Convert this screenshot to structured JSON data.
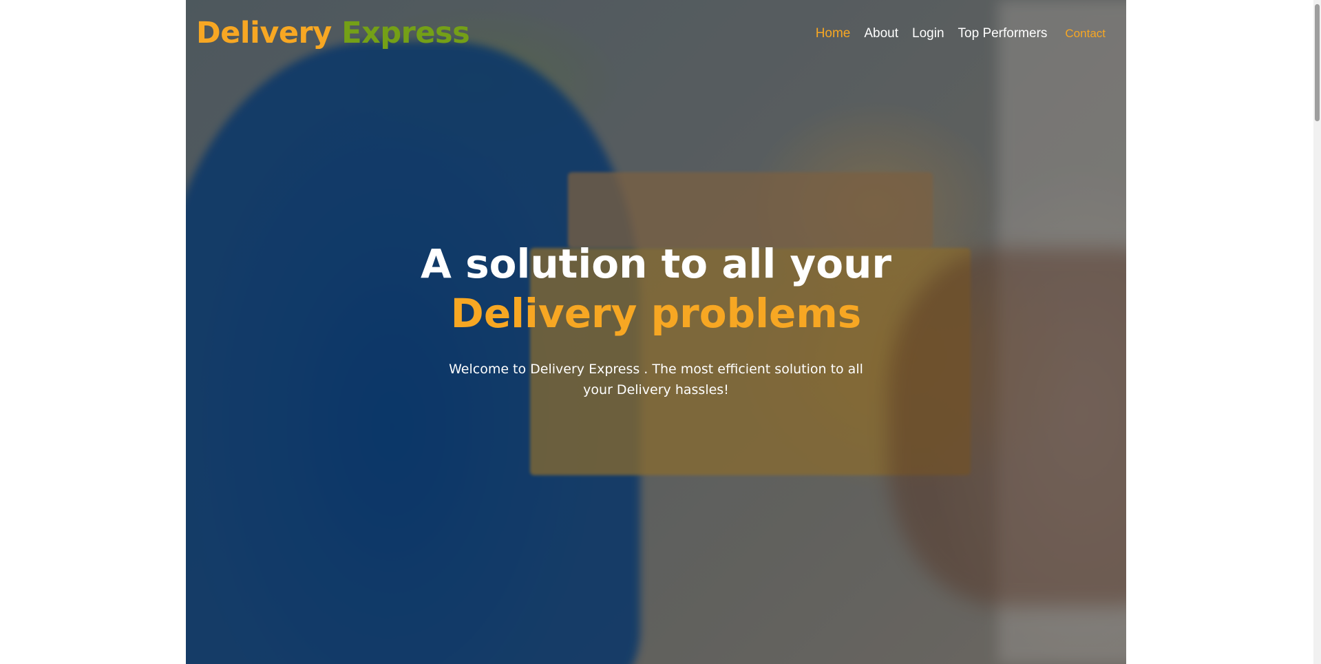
{
  "brand": {
    "word1": "Delivery",
    "word2": "Express"
  },
  "nav": {
    "home": "Home",
    "about": "About",
    "login": "Login",
    "top_performers": "Top Performers",
    "contact": "Contact"
  },
  "hero": {
    "headline_line1": "A solution to all your",
    "headline_line2": "Delivery problems",
    "tagline": "Welcome to Delivery Express . The most efficient solution to all your Delivery hassles!"
  },
  "colors": {
    "accent_orange": "#f7a723",
    "accent_green": "#74a017"
  }
}
